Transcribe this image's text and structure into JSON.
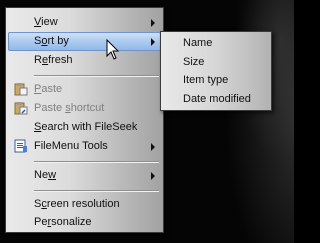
{
  "context_menu": {
    "items": [
      {
        "label": "View",
        "accel": "V",
        "rest": "iew"
      },
      {
        "label": "Sort by",
        "accel": "o",
        "pre": "S",
        "rest": "rt by"
      },
      {
        "label": "Refresh",
        "accel": "e",
        "pre": "R",
        "rest": "fresh"
      },
      {
        "label": "Paste",
        "accel": "P",
        "rest": "aste"
      },
      {
        "label": "Paste shortcut",
        "accel": "s",
        "pre": "Paste ",
        "rest": "hortcut"
      },
      {
        "label": "Search with FileSeek",
        "accel": "S",
        "rest": "earch with FileSeek"
      },
      {
        "label": "FileMenu Tools"
      },
      {
        "label": "New",
        "accel": "w",
        "pre": "Ne",
        "rest": ""
      },
      {
        "label": "Screen resolution",
        "accel": "c",
        "pre": "S",
        "rest": "reen resolution"
      },
      {
        "label": "Personalize",
        "accel": "r",
        "pre": "Pe",
        "rest": "sonalize"
      }
    ]
  },
  "submenu": {
    "items": [
      "Name",
      "Size",
      "Item type",
      "Date modified"
    ]
  },
  "colors": {
    "highlight": "#a9c8ee",
    "disabled_text": "#7f7f7f"
  }
}
